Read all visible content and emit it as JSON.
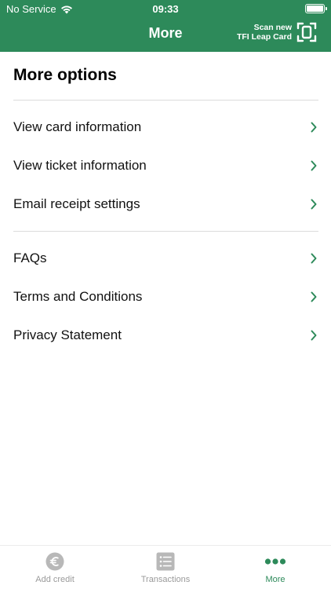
{
  "status_bar": {
    "carrier": "No Service",
    "time": "09:33"
  },
  "header": {
    "title": "More",
    "scan_line1": "Scan new",
    "scan_line2": "TFI Leap Card"
  },
  "main": {
    "title": "More options",
    "section1": [
      {
        "label": "View card information"
      },
      {
        "label": "View ticket information"
      },
      {
        "label": "Email receipt settings"
      }
    ],
    "section2": [
      {
        "label": "FAQs"
      },
      {
        "label": "Terms and Conditions"
      },
      {
        "label": "Privacy Statement"
      }
    ]
  },
  "tabbar": {
    "items": [
      {
        "label": "Add credit",
        "icon": "euro-icon",
        "active": false
      },
      {
        "label": "Transactions",
        "icon": "list-icon",
        "active": false
      },
      {
        "label": "More",
        "icon": "more-dots-icon",
        "active": true
      }
    ]
  },
  "colors": {
    "brand_green": "#2d8a5a",
    "inactive_gray": "#9a9a9a"
  }
}
